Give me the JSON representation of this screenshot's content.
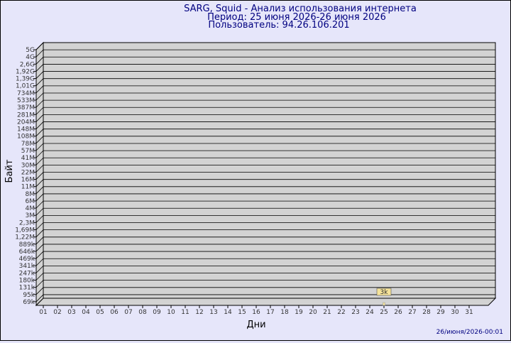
{
  "header": {
    "title": "SARG, Squid - Анализ использования интернета",
    "period": "Период: 25 июня 2026-26 июня 2026",
    "user": "Пользователь: 94.26.106.201"
  },
  "footer": {
    "timestamp": "26/июня/2026-00:01"
  },
  "colors": {
    "background": "#e6e6fa",
    "plot": "#d3d3d3",
    "grid": "#000000",
    "title": "#000080",
    "bar_fill": "#f5e39a",
    "bar_label_bg": "#f5e39a"
  },
  "chart_data": {
    "type": "bar",
    "xlabel": "Дни",
    "ylabel": "Байт",
    "y_scale": "log",
    "y_ticks": [
      "5G",
      "4G",
      "2,6G",
      "1,92G",
      "1,39G",
      "1,01G",
      "734M",
      "533M",
      "387M",
      "281M",
      "204M",
      "148M",
      "108M",
      "78M",
      "57M",
      "41M",
      "30M",
      "22M",
      "16M",
      "11M",
      "8M",
      "6M",
      "4M",
      "3M",
      "2,3M",
      "1,69M",
      "1,22M",
      "889k",
      "646k",
      "469k",
      "341k",
      "247k",
      "180k",
      "131k",
      "95k",
      "69k"
    ],
    "categories": [
      "01",
      "02",
      "03",
      "04",
      "05",
      "06",
      "07",
      "08",
      "09",
      "10",
      "11",
      "12",
      "13",
      "14",
      "15",
      "16",
      "17",
      "18",
      "19",
      "20",
      "21",
      "22",
      "23",
      "24",
      "25",
      "26",
      "27",
      "28",
      "29",
      "30",
      "31"
    ],
    "values": [
      null,
      null,
      null,
      null,
      null,
      null,
      null,
      null,
      null,
      null,
      null,
      null,
      null,
      null,
      null,
      null,
      null,
      null,
      null,
      null,
      null,
      null,
      null,
      null,
      3000,
      null,
      null,
      null,
      null,
      null,
      null
    ],
    "data_labels": {
      "25": "3k"
    },
    "grid": true
  }
}
